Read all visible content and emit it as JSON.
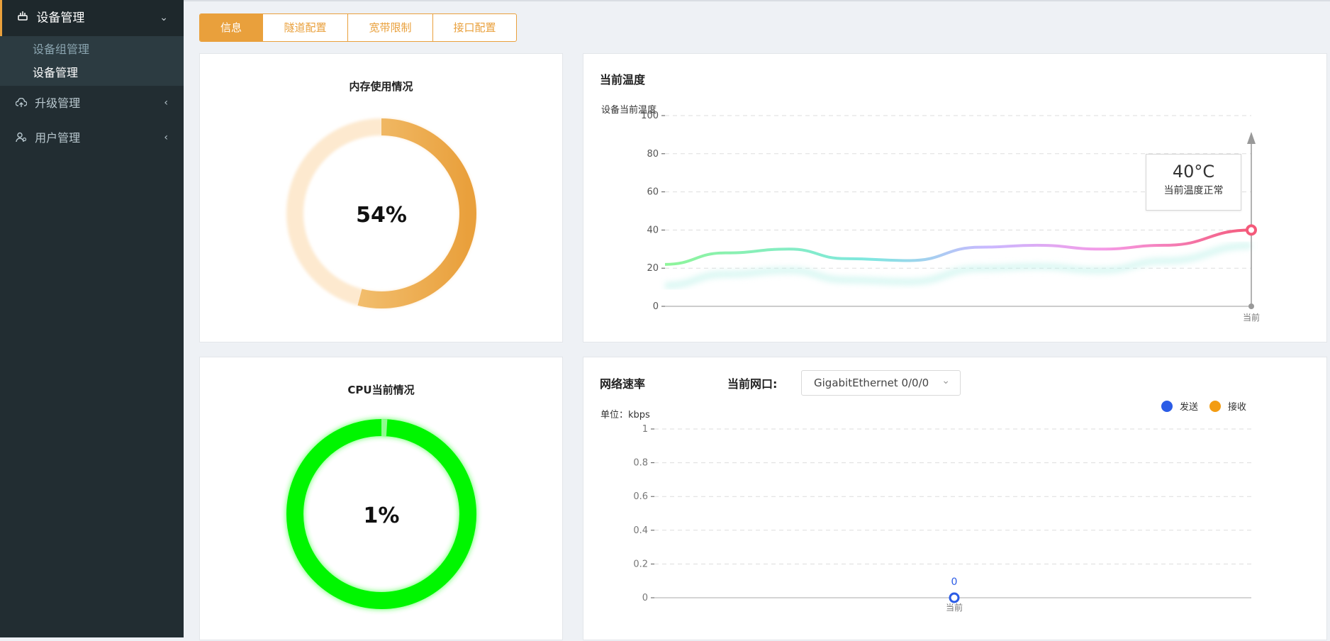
{
  "sidebar": {
    "groups": [
      {
        "label": "设备管理",
        "icon": "device-icon",
        "expanded": true,
        "items": [
          {
            "label": "设备组管理"
          },
          {
            "label": "设备管理"
          }
        ]
      },
      {
        "label": "升级管理",
        "icon": "cloud-upload-icon"
      },
      {
        "label": "用户管理",
        "icon": "user-icon"
      }
    ]
  },
  "tabs": [
    {
      "label": "信息",
      "active": true
    },
    {
      "label": "隧道配置"
    },
    {
      "label": "宽带限制"
    },
    {
      "label": "接口配置"
    }
  ],
  "memory": {
    "title": "内存使用情况",
    "percent": 54,
    "label": "54%"
  },
  "cpu": {
    "title": "CPU当前情况",
    "percent": 1,
    "label": "1%"
  },
  "temperature": {
    "title": "当前温度",
    "subtitle": "设备当前温度",
    "tooltip": {
      "value": "40°C",
      "text": "当前温度正常"
    },
    "x_label": "当前"
  },
  "network": {
    "title": "网络速率",
    "port_label": "当前网口:",
    "port_value": "GigabitEthernet 0/0/0",
    "unit": "单位：kbps",
    "legend": [
      {
        "name": "发送",
        "color": "#2b5ce6"
      },
      {
        "name": "接收",
        "color": "#f39c12"
      }
    ],
    "x_label": "当前",
    "point_label": "0"
  },
  "chart_data": [
    {
      "type": "pie",
      "title": "内存使用情况",
      "values": [
        54,
        46
      ],
      "labels": [
        "54%"
      ]
    },
    {
      "type": "pie",
      "title": "CPU当前情况",
      "values": [
        1,
        99
      ],
      "labels": [
        "1%"
      ]
    },
    {
      "type": "line",
      "title": "当前温度",
      "ylabel": "设备当前温度",
      "ylim": [
        0,
        100
      ],
      "yticks": [
        0,
        20,
        40,
        60,
        80,
        100
      ],
      "categories": [
        "当前"
      ],
      "series": [
        {
          "values": [
            40
          ]
        }
      ],
      "grid": true
    },
    {
      "type": "line",
      "title": "网络速率",
      "ylabel": "单位：kbps",
      "ylim": [
        0,
        1
      ],
      "yticks": [
        0,
        0.2,
        0.4,
        0.6,
        0.8,
        1
      ],
      "categories": [
        "当前"
      ],
      "series": [
        {
          "name": "发送",
          "values": [
            0
          ]
        },
        {
          "name": "接收",
          "values": [
            0
          ]
        }
      ],
      "legend": "top-right",
      "grid": true
    }
  ]
}
